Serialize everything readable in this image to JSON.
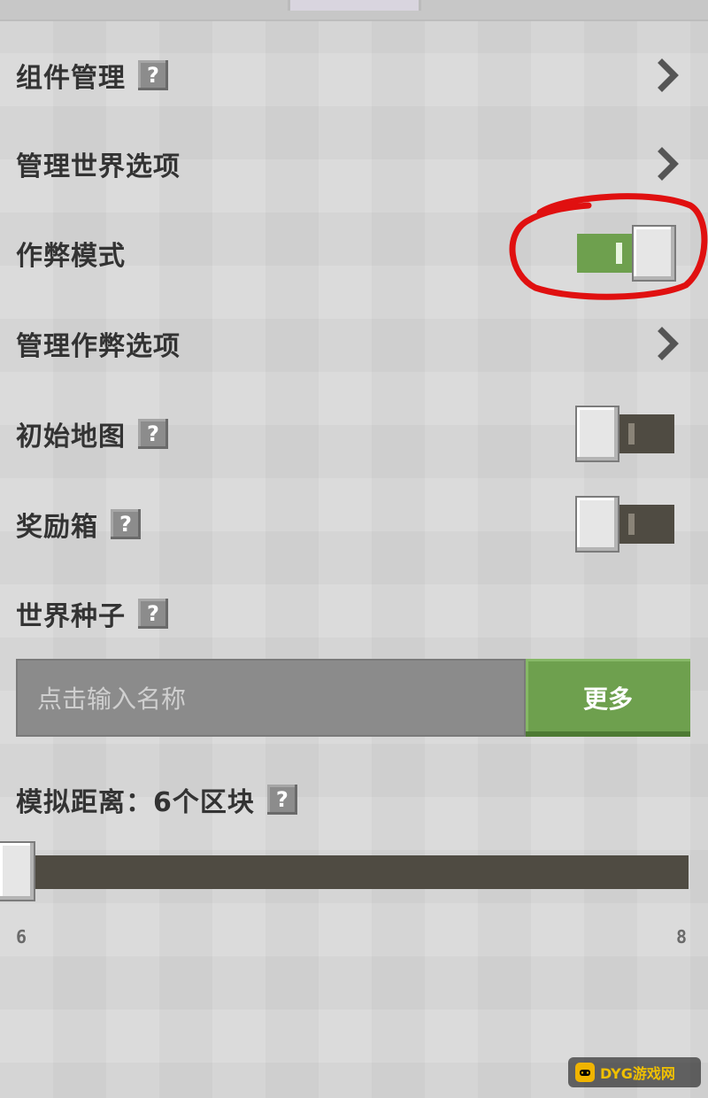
{
  "settings": {
    "addons": {
      "label": "组件管理",
      "help": "?"
    },
    "world_options": {
      "label": "管理世界选项"
    },
    "cheats": {
      "label": "作弊模式",
      "enabled": true
    },
    "cheat_options": {
      "label": "管理作弊选项"
    },
    "starting_map": {
      "label": "初始地图",
      "help": "?",
      "enabled": false
    },
    "bonus_chest": {
      "label": "奖励箱",
      "help": "?",
      "enabled": false
    },
    "world_seed": {
      "label": "世界种子",
      "help": "?",
      "placeholder": "点击输入名称",
      "more_button": "更多"
    },
    "simulation_distance": {
      "label": "模拟距离：6个区块",
      "help": "?",
      "value": 6,
      "min_label": "6",
      "max_label": "8"
    }
  },
  "colors": {
    "background": "#d7d7d7",
    "toggle_on": "#6ea04e",
    "toggle_off": "#4f4b42",
    "annotation_circle": "#e01010"
  },
  "watermark": {
    "text": "DYG游戏网",
    "icon": "gamepad-icon"
  }
}
